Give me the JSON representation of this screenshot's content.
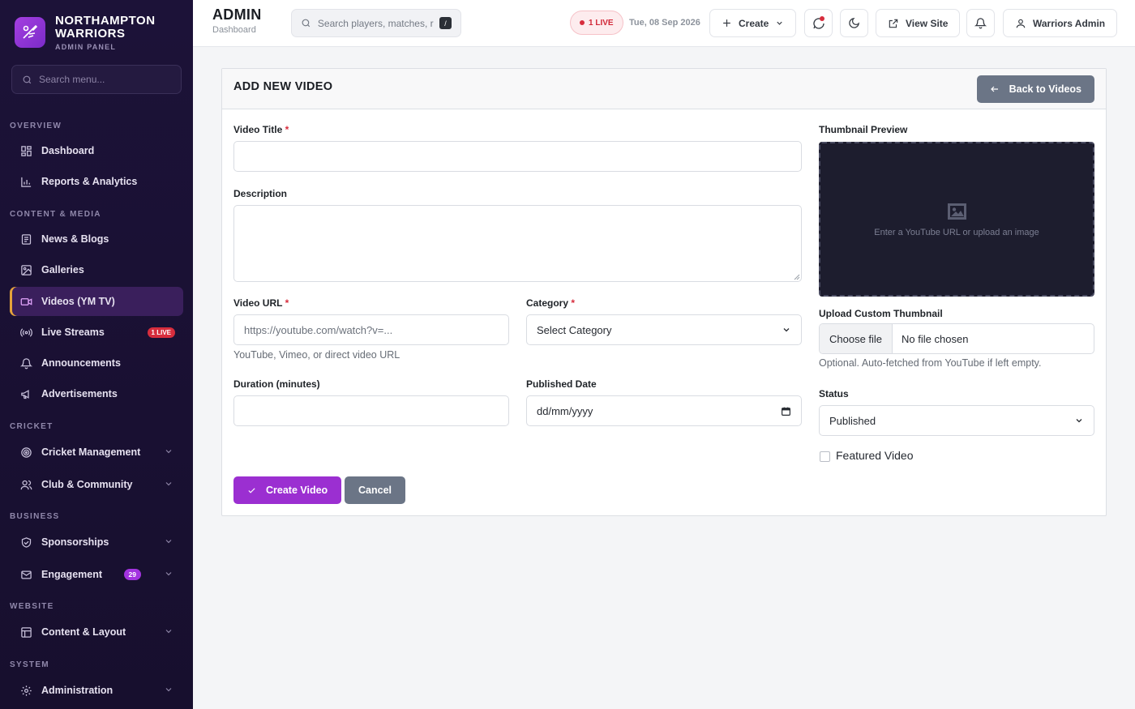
{
  "brand": {
    "name_line1": "NORTHAMPTON",
    "name_line2": "WARRIORS",
    "sub": "ADMIN PANEL"
  },
  "sidebar": {
    "search_placeholder": "Search menu...",
    "sections": {
      "overview": "OVERVIEW",
      "content": "CONTENT & MEDIA",
      "cricket": "CRICKET",
      "business": "BUSINESS",
      "website": "WEBSITE",
      "system": "SYSTEM"
    },
    "items": {
      "dashboard": "Dashboard",
      "reports": "Reports & Analytics",
      "news": "News & Blogs",
      "galleries": "Galleries",
      "videos": "Videos (YM TV)",
      "live": "Live Streams",
      "live_badge": "1 LIVE",
      "announcements": "Announcements",
      "advertisements": "Advertisements",
      "cricket_mgmt": "Cricket Management",
      "club": "Club & Community",
      "sponsorships": "Sponsorships",
      "engagement": "Engagement",
      "engagement_badge": "29",
      "content_layout": "Content & Layout",
      "administration": "Administration"
    }
  },
  "header": {
    "title": "ADMIN",
    "subtitle": "Dashboard",
    "search_placeholder": "Search players, matches, r",
    "search_shortcut": "/",
    "live_label": "1 LIVE",
    "date": "Tue, 08 Sep 2026",
    "create_label": "Create",
    "view_site_label": "View Site",
    "user_label": "Warriors Admin"
  },
  "form": {
    "title": "ADD NEW VIDEO",
    "back_label": "Back to Videos",
    "video_title_label": "Video Title",
    "required_mark": "*",
    "video_title_value": "",
    "description_label": "Description",
    "description_value": "",
    "video_url_label": "Video URL",
    "video_url_placeholder": "https://youtube.com/watch?v=...",
    "video_url_help": "YouTube, Vimeo, or direct video URL",
    "category_label": "Category",
    "category_selected": "Select Category",
    "duration_label": "Duration (minutes)",
    "duration_value": "",
    "published_date_label": "Published Date",
    "published_date_placeholder": "dd/mm/yyyy",
    "thumbnail_label": "Thumbnail Preview",
    "thumbnail_hint": "Enter a YouTube URL or upload an image",
    "upload_label": "Upload Custom Thumbnail",
    "upload_button": "Choose file",
    "upload_file": "No file chosen",
    "upload_help": "Optional. Auto-fetched from YouTube if left empty.",
    "status_label": "Status",
    "status_selected": "Published",
    "featured_label": "Featured Video",
    "featured_checked": false,
    "submit_label": "Create Video",
    "cancel_label": "Cancel"
  },
  "colors": {
    "sidebar_bg": "#1c1238",
    "accent": "#9b2fd1",
    "live": "#d72d3d",
    "secondary_btn": "#6b7586"
  }
}
